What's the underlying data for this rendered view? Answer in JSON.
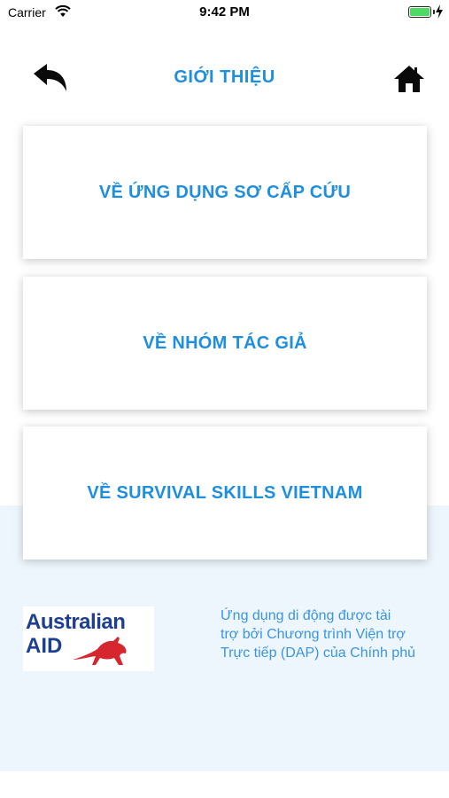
{
  "status_bar": {
    "carrier": "Carrier",
    "time": "9:42 PM",
    "battery_color": "#4cd964"
  },
  "nav": {
    "title": "GIỚI THIỆU",
    "back_icon": "back-arrow-icon",
    "home_icon": "home-icon",
    "accent_color": "#1e8fe0"
  },
  "menu": {
    "items": [
      {
        "label": "VỀ ỨNG DỤNG SƠ CẤP CỨU"
      },
      {
        "label": "VỀ NHÓM TÁC GIẢ"
      },
      {
        "label": "VỀ SURVIVAL SKILLS VIETNAM"
      }
    ]
  },
  "footer": {
    "logo_line1": "Australian",
    "logo_line2": "AID",
    "logo_icon": "kangaroo-icon",
    "sponsor_lines": [
      "Ứng dụng di động được tài",
      "trợ bởi Chương trình Viện trợ",
      "Trực tiếp (DAP) của Chính phủ"
    ]
  }
}
